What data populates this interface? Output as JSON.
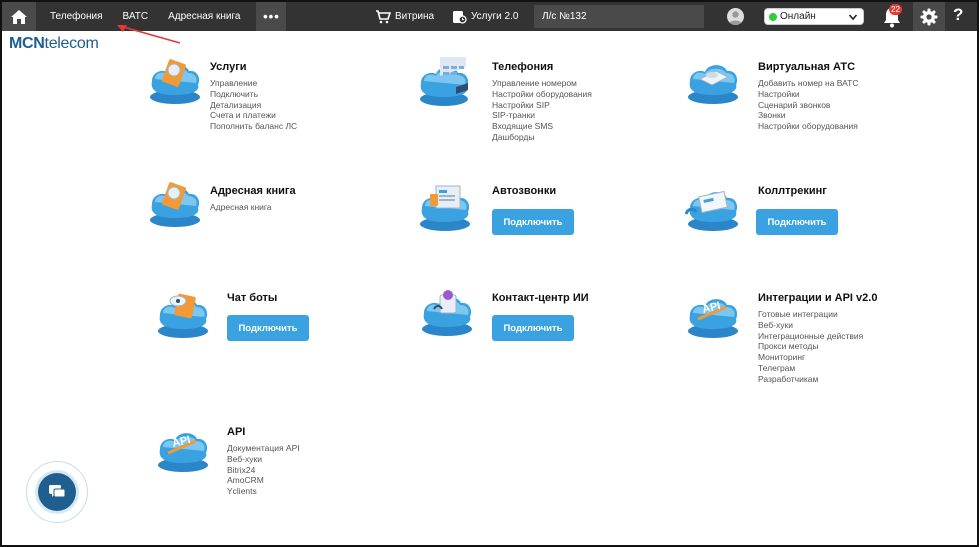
{
  "topbar": {
    "nav": [
      "Телефония",
      "ВАТС",
      "Адресная книга"
    ],
    "more": "•••",
    "shop_label": "Витрина",
    "services_label": "Услуги 2.0",
    "account": "Л/с №132",
    "status": "Онлайн",
    "notifications_count": "22",
    "help": "?"
  },
  "logo": {
    "bold": "MCN",
    "rest": "telecom"
  },
  "cards": {
    "uslugi": {
      "title": "Услуги",
      "links": [
        "Управление",
        "Подключить",
        "Детализация",
        "Счета и платежи",
        "Пополнить баланс ЛС"
      ]
    },
    "telefonia": {
      "title": "Телефония",
      "links": [
        "Управление номером",
        "Настройки оборудования",
        "Настройки SIP",
        "SIP-транки",
        "Входящие SMS",
        "Дашборды"
      ]
    },
    "vats": {
      "title": "Виртуальная АТС",
      "links": [
        "Добавить номер на ВАТС",
        "Настройки",
        "Сценарий звонков",
        "Звонки",
        "Настройки оборудования"
      ]
    },
    "addressbook": {
      "title": "Адресная книга",
      "links": [
        "Адресная книга"
      ]
    },
    "autocalls": {
      "title": "Автозвонки",
      "button": "Подключить"
    },
    "calltracking": {
      "title": "Коллтрекинг",
      "button": "Подключить"
    },
    "chatbots": {
      "title": "Чат боты",
      "button": "Подключить"
    },
    "contactcenter": {
      "title": "Контакт-центр ИИ",
      "button": "Подключить"
    },
    "integrations": {
      "title": "Интеграции и API v2.0",
      "links": [
        "Готовые интеграции",
        "Веб-хуки",
        "Интеграционные действия",
        "Прокси методы",
        "Мониторинг",
        "Телеграм",
        "Разработчикам"
      ]
    },
    "api": {
      "title": "API",
      "links": [
        "Документация API",
        "Веб-хуки",
        "Bitrix24",
        "AmoCRM",
        "Yclients"
      ],
      "icon_text": "API"
    }
  },
  "colors": {
    "accent": "#3aa2e0",
    "topbar": "#333333",
    "logo": "#1c5d92",
    "badge": "#e53935",
    "online": "#2ecc40"
  },
  "icons": [
    "home-icon",
    "cart-icon",
    "services-icon",
    "avatar-icon",
    "chevron-down-icon",
    "bell-icon",
    "gear-icon",
    "chat-icon"
  ]
}
